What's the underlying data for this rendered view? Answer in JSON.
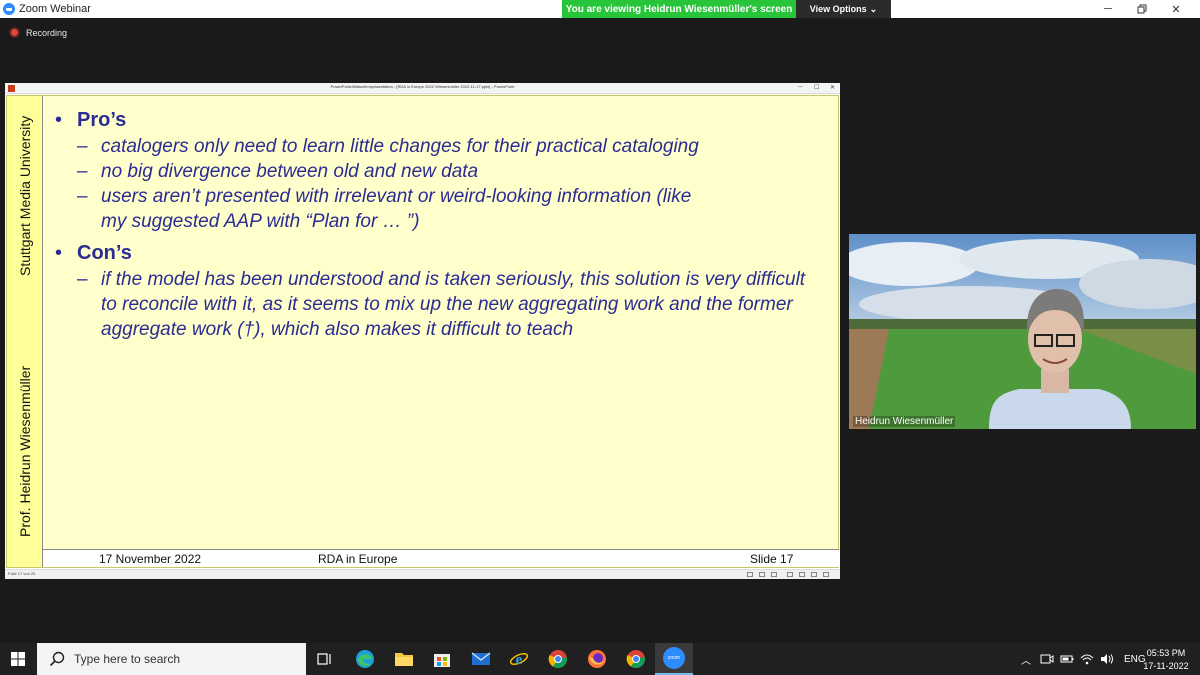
{
  "zoom": {
    "app_title": "Zoom Webinar",
    "banner": "You are viewing Heidrun Wiesenmüller's screen",
    "view_options": "View Options",
    "recording": "Recording"
  },
  "ppt": {
    "window_title": "PowerPoint-Bildschirmpräsentation - [RDA in Europe 2022 Wiesenmüller 2022-11-17.pptx] - PowerPoint",
    "status_left": "Folie 17 von 20"
  },
  "slide": {
    "sidebar_top": "Stuttgart Media University",
    "sidebar_bottom": "Prof. Heidrun Wiesenmüller",
    "bullet_glyph": "•",
    "dash_glyph": "–",
    "pros": {
      "heading": "Pro’s",
      "items": [
        "catalogers only need to learn little changes for their practical cataloging",
        "no big divergence between old and new data",
        "users aren’t presented with irrelevant or weird-looking information (like my suggested AAP with “Plan for … ”)"
      ]
    },
    "cons": {
      "heading": "Con’s",
      "items": [
        "if the model has been understood and is taken seriously, this solution is very difficult to reconcile with it, as it seems to mix up the new aggregating work and the former aggregate work (†), which also makes it difficult to teach"
      ]
    },
    "footer": {
      "date": "17 November 2022",
      "title": "RDA in Europe",
      "slide_no": "Slide 17"
    }
  },
  "participant": {
    "name": "Heidrun Wiesenmüller"
  },
  "taskbar": {
    "search_placeholder": "Type here to search",
    "apps": [
      "task-view",
      "edge",
      "file-explorer",
      "store",
      "mail",
      "internet-explorer",
      "chrome",
      "firefox",
      "chrome-2",
      "zoom"
    ],
    "zoom_label": "zoom",
    "language": "ENG",
    "time": "05:53 PM",
    "date": "17-11-2022"
  },
  "colors": {
    "banner_green": "#28c53b",
    "slide_bg": "#ffffcc",
    "sidebar_bg": "#ffff99",
    "slide_text": "#2b2b94",
    "zoom_blue": "#2d8cff"
  }
}
